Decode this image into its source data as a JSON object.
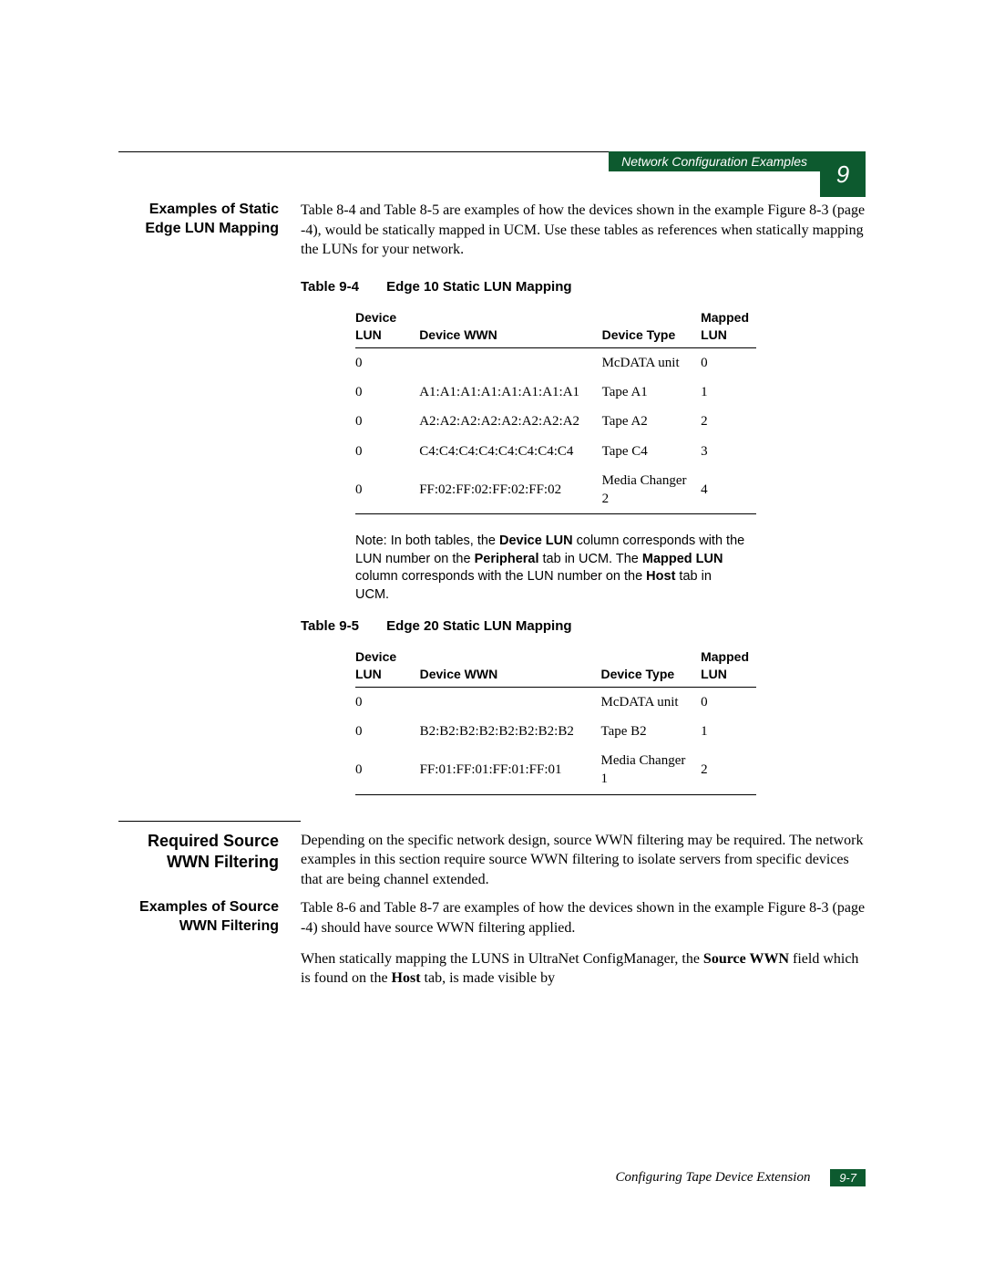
{
  "header": {
    "section": "Network Configuration Examples",
    "chapter": "9"
  },
  "s1": {
    "title": "Examples of Static Edge LUN Mapping",
    "para": "Table 8-4 and Table 8-5 are examples of how the devices shown in the example Figure 8-3 (page -4), would be statically mapped in UCM. Use these tables as references when statically mapping the LUNs for your network."
  },
  "t94": {
    "num": "Table 9-4",
    "title": "Edge 10 Static LUN Mapping",
    "h": {
      "c1": "Device LUN",
      "c2": "Device WWN",
      "c3": "Device Type",
      "c4": "Mapped LUN"
    },
    "r": [
      {
        "c1": "0",
        "c2": "",
        "c3": "McDATA unit",
        "c4": "0"
      },
      {
        "c1": "0",
        "c2": "A1:A1:A1:A1:A1:A1:A1:A1",
        "c3": "Tape A1",
        "c4": "1"
      },
      {
        "c1": "0",
        "c2": "A2:A2:A2:A2:A2:A2:A2:A2",
        "c3": "Tape A2",
        "c4": "2"
      },
      {
        "c1": "0",
        "c2": "C4:C4:C4:C4:C4:C4:C4:C4",
        "c3": "Tape C4",
        "c4": "3"
      },
      {
        "c1": "0",
        "c2": "FF:02:FF:02:FF:02:FF:02",
        "c3": "Media Changer 2",
        "c4": "4"
      }
    ]
  },
  "note": {
    "prefix": "Note:",
    "t1": "In both tables, the ",
    "b1": "Device LUN",
    "t2": " column corresponds with the LUN number on the ",
    "b2": "Peripheral",
    "t3": " tab in UCM. The ",
    "b3": "Mapped LUN",
    "t4": " column corresponds with the LUN number on the ",
    "b4": "Host",
    "t5": " tab in UCM."
  },
  "t95": {
    "num": "Table 9-5",
    "title": "Edge 20 Static LUN Mapping",
    "h": {
      "c1": "Device LUN",
      "c2": "Device WWN",
      "c3": "Device Type",
      "c4": "Mapped LUN"
    },
    "r": [
      {
        "c1": "0",
        "c2": "",
        "c3": "McDATA unit",
        "c4": "0"
      },
      {
        "c1": "0",
        "c2": "B2:B2:B2:B2:B2:B2:B2:B2",
        "c3": "Tape B2",
        "c4": "1"
      },
      {
        "c1": "0",
        "c2": "FF:01:FF:01:FF:01:FF:01",
        "c3": "Media Changer 1",
        "c4": "2"
      }
    ]
  },
  "s2": {
    "title": "Required Source WWN Filtering",
    "para": "Depending on the specific network design, source WWN filtering may be required. The network examples in this section require source WWN filtering to isolate servers from specific devices that are being channel extended."
  },
  "s3": {
    "title": "Examples of Source WWN Filtering",
    "para1": "Table 8-6 and Table 8-7 are examples of how the devices shown in the example Figure 8-3 (page -4) should have source WWN filtering applied.",
    "p2a": "When statically mapping the LUNS in UltraNet ConfigManager, the ",
    "p2b": "Source WWN",
    "p2c": " field which is found on the ",
    "p2d": "Host",
    "p2e": " tab, is made visible by"
  },
  "footer": {
    "text": "Configuring Tape Device Extension",
    "page": "9-7"
  }
}
